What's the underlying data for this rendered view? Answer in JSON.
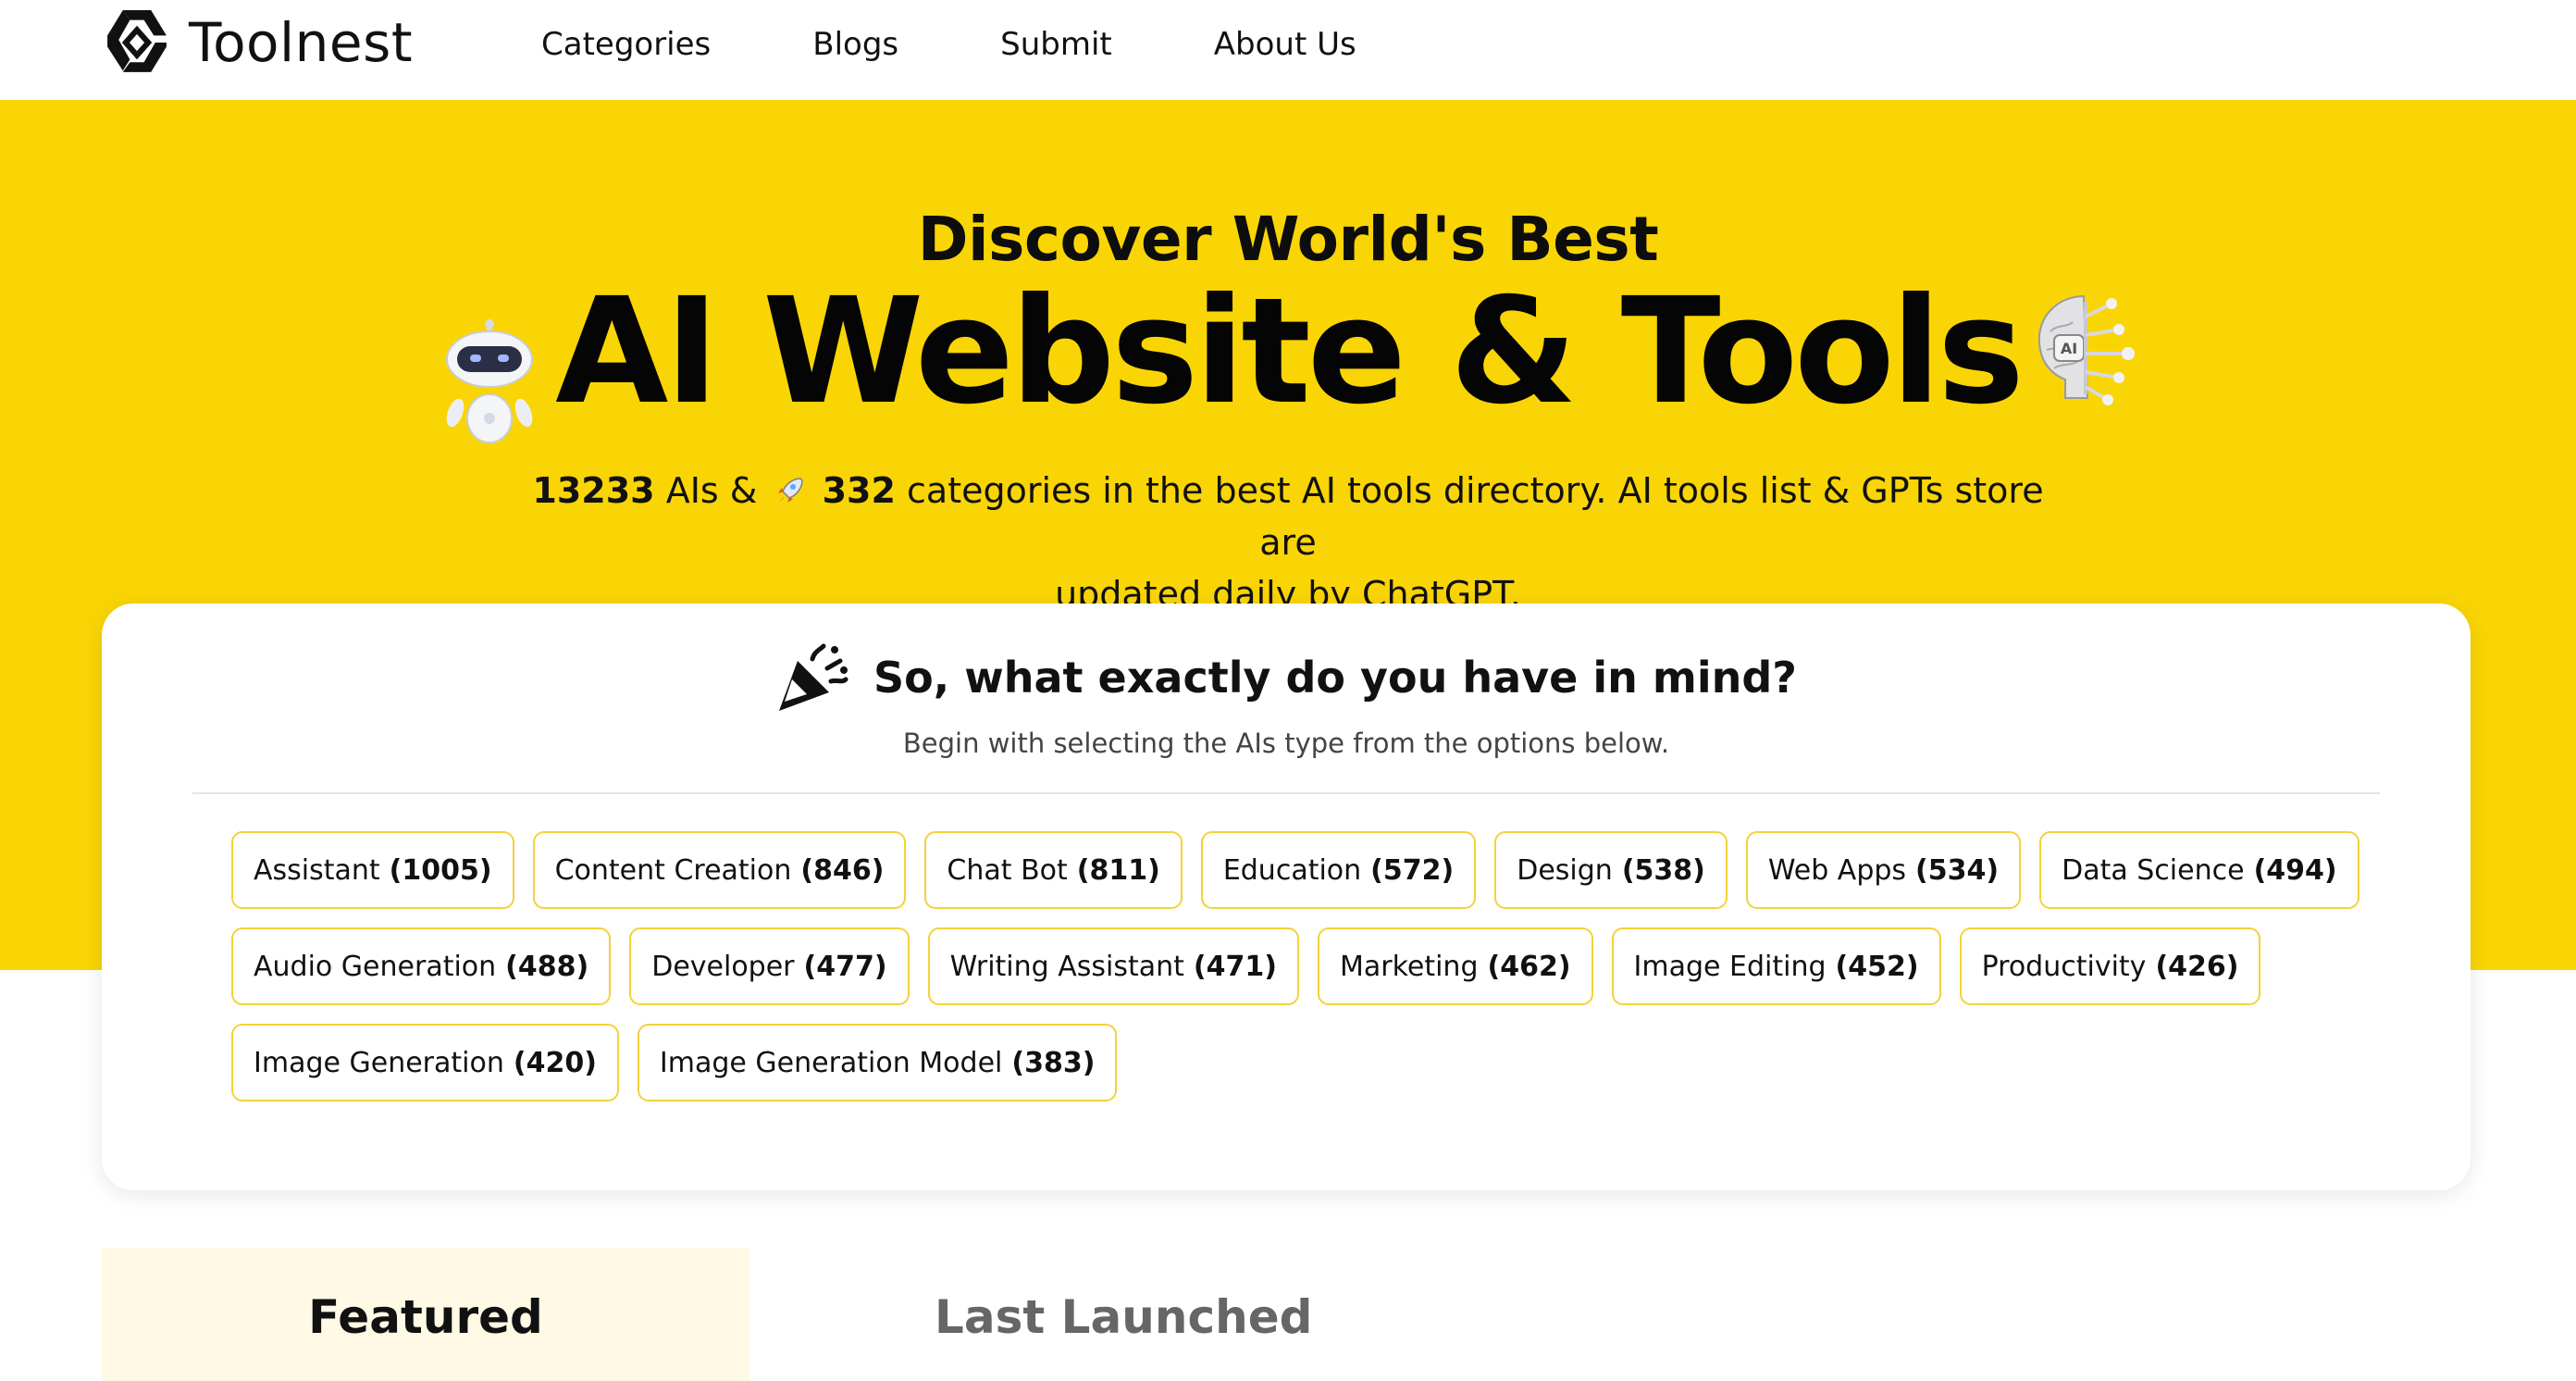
{
  "header": {
    "logo_text": "Toolnest",
    "nav": [
      "Categories",
      "Blogs",
      "Submit",
      "About Us"
    ]
  },
  "hero": {
    "subtitle": "Discover World's Best",
    "title": "AI Website & Tools",
    "ai_count": "13233",
    "ai_label": "AIs &",
    "category_count": "332",
    "desc_line1_rest": "categories in the best AI tools directory. AI tools list & GPTs store are",
    "desc_line2": "updated daily by ChatGPT."
  },
  "card": {
    "title": "So, what exactly do you have in mind?",
    "description": "Begin with selecting the AIs type from the options below.",
    "rows": [
      [
        {
          "label": "Assistant",
          "count": "(1005)"
        },
        {
          "label": "Content Creation",
          "count": "(846)"
        },
        {
          "label": "Chat Bot",
          "count": "(811)"
        },
        {
          "label": "Education",
          "count": "(572)"
        },
        {
          "label": "Design",
          "count": "(538)"
        },
        {
          "label": "Web Apps",
          "count": "(534)"
        },
        {
          "label": "Data Science",
          "count": "(494)"
        }
      ],
      [
        {
          "label": "Audio Generation",
          "count": "(488)"
        },
        {
          "label": "Developer",
          "count": "(477)"
        },
        {
          "label": "Writing Assistant",
          "count": "(471)"
        },
        {
          "label": "Marketing",
          "count": "(462)"
        },
        {
          "label": "Image Editing",
          "count": "(452)"
        },
        {
          "label": "Productivity",
          "count": "(426)"
        }
      ],
      [
        {
          "label": "Image Generation",
          "count": "(420)"
        },
        {
          "label": "Image Generation Model",
          "count": "(383)"
        }
      ]
    ]
  },
  "tabs": {
    "featured": "Featured",
    "last_launched": "Last Launched"
  },
  "colors": {
    "brand_yellow": "#FAD505",
    "chip_border": "#F3D23A",
    "featured_tab_bg": "#FFF9E6"
  },
  "icons": [
    "toolnest-logo-icon",
    "robot-icon",
    "rocket-icon",
    "ai-brain-icon",
    "party-popper-icon"
  ]
}
